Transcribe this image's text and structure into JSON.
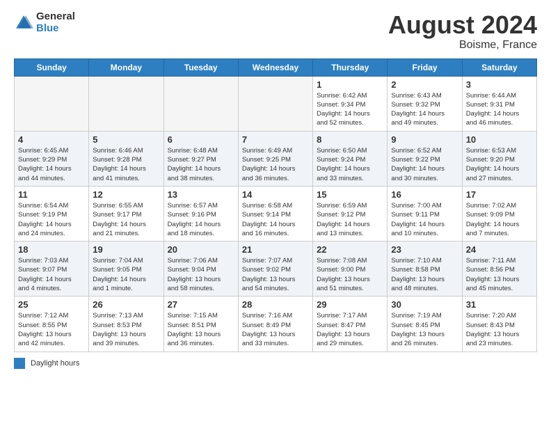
{
  "header": {
    "logo_line1": "General",
    "logo_line2": "Blue",
    "main_title": "August 2024",
    "sub_title": "Boisme, France"
  },
  "calendar": {
    "days_of_week": [
      "Sunday",
      "Monday",
      "Tuesday",
      "Wednesday",
      "Thursday",
      "Friday",
      "Saturday"
    ],
    "weeks": [
      [
        {
          "day": "",
          "info": ""
        },
        {
          "day": "",
          "info": ""
        },
        {
          "day": "",
          "info": ""
        },
        {
          "day": "",
          "info": ""
        },
        {
          "day": "1",
          "info": "Sunrise: 6:42 AM\nSunset: 9:34 PM\nDaylight: 14 hours\nand 52 minutes."
        },
        {
          "day": "2",
          "info": "Sunrise: 6:43 AM\nSunset: 9:32 PM\nDaylight: 14 hours\nand 49 minutes."
        },
        {
          "day": "3",
          "info": "Sunrise: 6:44 AM\nSunset: 9:31 PM\nDaylight: 14 hours\nand 46 minutes."
        }
      ],
      [
        {
          "day": "4",
          "info": "Sunrise: 6:45 AM\nSunset: 9:29 PM\nDaylight: 14 hours\nand 44 minutes."
        },
        {
          "day": "5",
          "info": "Sunrise: 6:46 AM\nSunset: 9:28 PM\nDaylight: 14 hours\nand 41 minutes."
        },
        {
          "day": "6",
          "info": "Sunrise: 6:48 AM\nSunset: 9:27 PM\nDaylight: 14 hours\nand 38 minutes."
        },
        {
          "day": "7",
          "info": "Sunrise: 6:49 AM\nSunset: 9:25 PM\nDaylight: 14 hours\nand 36 minutes."
        },
        {
          "day": "8",
          "info": "Sunrise: 6:50 AM\nSunset: 9:24 PM\nDaylight: 14 hours\nand 33 minutes."
        },
        {
          "day": "9",
          "info": "Sunrise: 6:52 AM\nSunset: 9:22 PM\nDaylight: 14 hours\nand 30 minutes."
        },
        {
          "day": "10",
          "info": "Sunrise: 6:53 AM\nSunset: 9:20 PM\nDaylight: 14 hours\nand 27 minutes."
        }
      ],
      [
        {
          "day": "11",
          "info": "Sunrise: 6:54 AM\nSunset: 9:19 PM\nDaylight: 14 hours\nand 24 minutes."
        },
        {
          "day": "12",
          "info": "Sunrise: 6:55 AM\nSunset: 9:17 PM\nDaylight: 14 hours\nand 21 minutes."
        },
        {
          "day": "13",
          "info": "Sunrise: 6:57 AM\nSunset: 9:16 PM\nDaylight: 14 hours\nand 18 minutes."
        },
        {
          "day": "14",
          "info": "Sunrise: 6:58 AM\nSunset: 9:14 PM\nDaylight: 14 hours\nand 16 minutes."
        },
        {
          "day": "15",
          "info": "Sunrise: 6:59 AM\nSunset: 9:12 PM\nDaylight: 14 hours\nand 13 minutes."
        },
        {
          "day": "16",
          "info": "Sunrise: 7:00 AM\nSunset: 9:11 PM\nDaylight: 14 hours\nand 10 minutes."
        },
        {
          "day": "17",
          "info": "Sunrise: 7:02 AM\nSunset: 9:09 PM\nDaylight: 14 hours\nand 7 minutes."
        }
      ],
      [
        {
          "day": "18",
          "info": "Sunrise: 7:03 AM\nSunset: 9:07 PM\nDaylight: 14 hours\nand 4 minutes."
        },
        {
          "day": "19",
          "info": "Sunrise: 7:04 AM\nSunset: 9:05 PM\nDaylight: 14 hours\nand 1 minute."
        },
        {
          "day": "20",
          "info": "Sunrise: 7:06 AM\nSunset: 9:04 PM\nDaylight: 13 hours\nand 58 minutes."
        },
        {
          "day": "21",
          "info": "Sunrise: 7:07 AM\nSunset: 9:02 PM\nDaylight: 13 hours\nand 54 minutes."
        },
        {
          "day": "22",
          "info": "Sunrise: 7:08 AM\nSunset: 9:00 PM\nDaylight: 13 hours\nand 51 minutes."
        },
        {
          "day": "23",
          "info": "Sunrise: 7:10 AM\nSunset: 8:58 PM\nDaylight: 13 hours\nand 48 minutes."
        },
        {
          "day": "24",
          "info": "Sunrise: 7:11 AM\nSunset: 8:56 PM\nDaylight: 13 hours\nand 45 minutes."
        }
      ],
      [
        {
          "day": "25",
          "info": "Sunrise: 7:12 AM\nSunset: 8:55 PM\nDaylight: 13 hours\nand 42 minutes."
        },
        {
          "day": "26",
          "info": "Sunrise: 7:13 AM\nSunset: 8:53 PM\nDaylight: 13 hours\nand 39 minutes."
        },
        {
          "day": "27",
          "info": "Sunrise: 7:15 AM\nSunset: 8:51 PM\nDaylight: 13 hours\nand 36 minutes."
        },
        {
          "day": "28",
          "info": "Sunrise: 7:16 AM\nSunset: 8:49 PM\nDaylight: 13 hours\nand 33 minutes."
        },
        {
          "day": "29",
          "info": "Sunrise: 7:17 AM\nSunset: 8:47 PM\nDaylight: 13 hours\nand 29 minutes."
        },
        {
          "day": "30",
          "info": "Sunrise: 7:19 AM\nSunset: 8:45 PM\nDaylight: 13 hours\nand 26 minutes."
        },
        {
          "day": "31",
          "info": "Sunrise: 7:20 AM\nSunset: 8:43 PM\nDaylight: 13 hours\nand 23 minutes."
        }
      ]
    ]
  },
  "legend": {
    "label": "Daylight hours"
  }
}
